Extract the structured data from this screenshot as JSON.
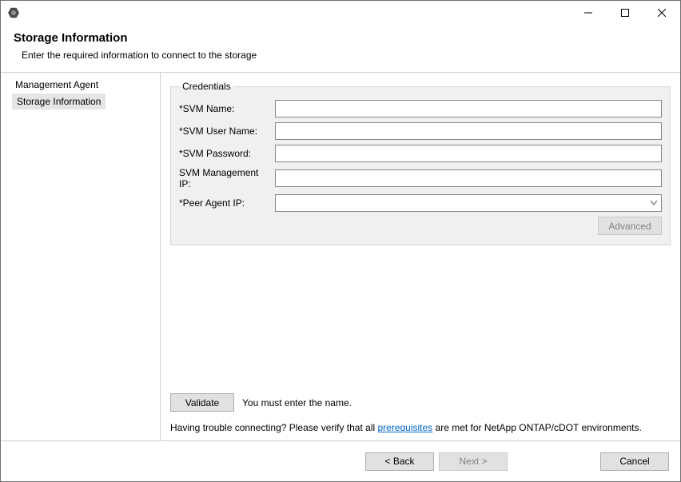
{
  "header": {
    "title": "Storage Information",
    "subtitle": "Enter the required information to connect to the storage"
  },
  "sidebar": {
    "items": [
      {
        "label": "Management Agent",
        "selected": false
      },
      {
        "label": "Storage Information",
        "selected": true
      }
    ]
  },
  "credentials": {
    "legend": "Credentials",
    "fields": {
      "svm_name": {
        "label": "*SVM Name:",
        "value": ""
      },
      "svm_user": {
        "label": "*SVM User Name:",
        "value": ""
      },
      "svm_password": {
        "label": "*SVM Password:",
        "value": ""
      },
      "mgmt_ip": {
        "label": "SVM Management IP:",
        "value": ""
      },
      "peer_agent": {
        "label": "*Peer Agent IP:",
        "value": ""
      }
    },
    "advanced_label": "Advanced"
  },
  "validate": {
    "button": "Validate",
    "message": "You must enter the name."
  },
  "help": {
    "prefix": "Having trouble connecting? Please verify that all ",
    "link": "prerequisites",
    "suffix": " are met for NetApp ONTAP/cDOT environments."
  },
  "footer": {
    "back": "< Back",
    "next": "Next >",
    "cancel": "Cancel"
  }
}
